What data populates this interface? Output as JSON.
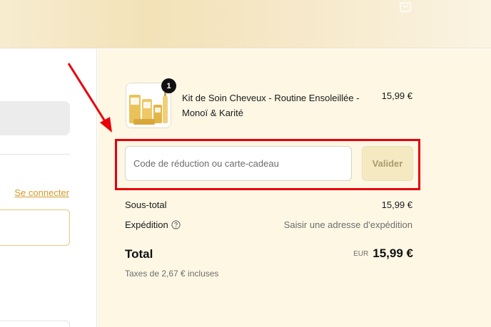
{
  "header": {
    "cart_icon": "shopping-bag-icon"
  },
  "left": {
    "login_link": "Se connecter"
  },
  "order": {
    "product": {
      "quantity": "1",
      "name": "Kit de Soin Cheveux - Routine Ensoleillée - Monoï & Karité",
      "price": "15,99 €"
    },
    "discount": {
      "placeholder": "Code de réduction ou carte-cadeau",
      "value": "",
      "button_label": "Valider"
    },
    "subtotal": {
      "label": "Sous-total",
      "value": "15,99 €"
    },
    "shipping": {
      "label": "Expédition",
      "value": "Saisir une adresse d'expédition",
      "help_icon": "question-circle-icon"
    },
    "total": {
      "label": "Total",
      "currency": "EUR",
      "amount": "15,99 €"
    },
    "taxes": "Taxes de 2,67 € incluses"
  },
  "colors": {
    "highlight": "#e8000b",
    "accent_link": "#d39a2a",
    "summary_background": "#fdf7e4"
  }
}
